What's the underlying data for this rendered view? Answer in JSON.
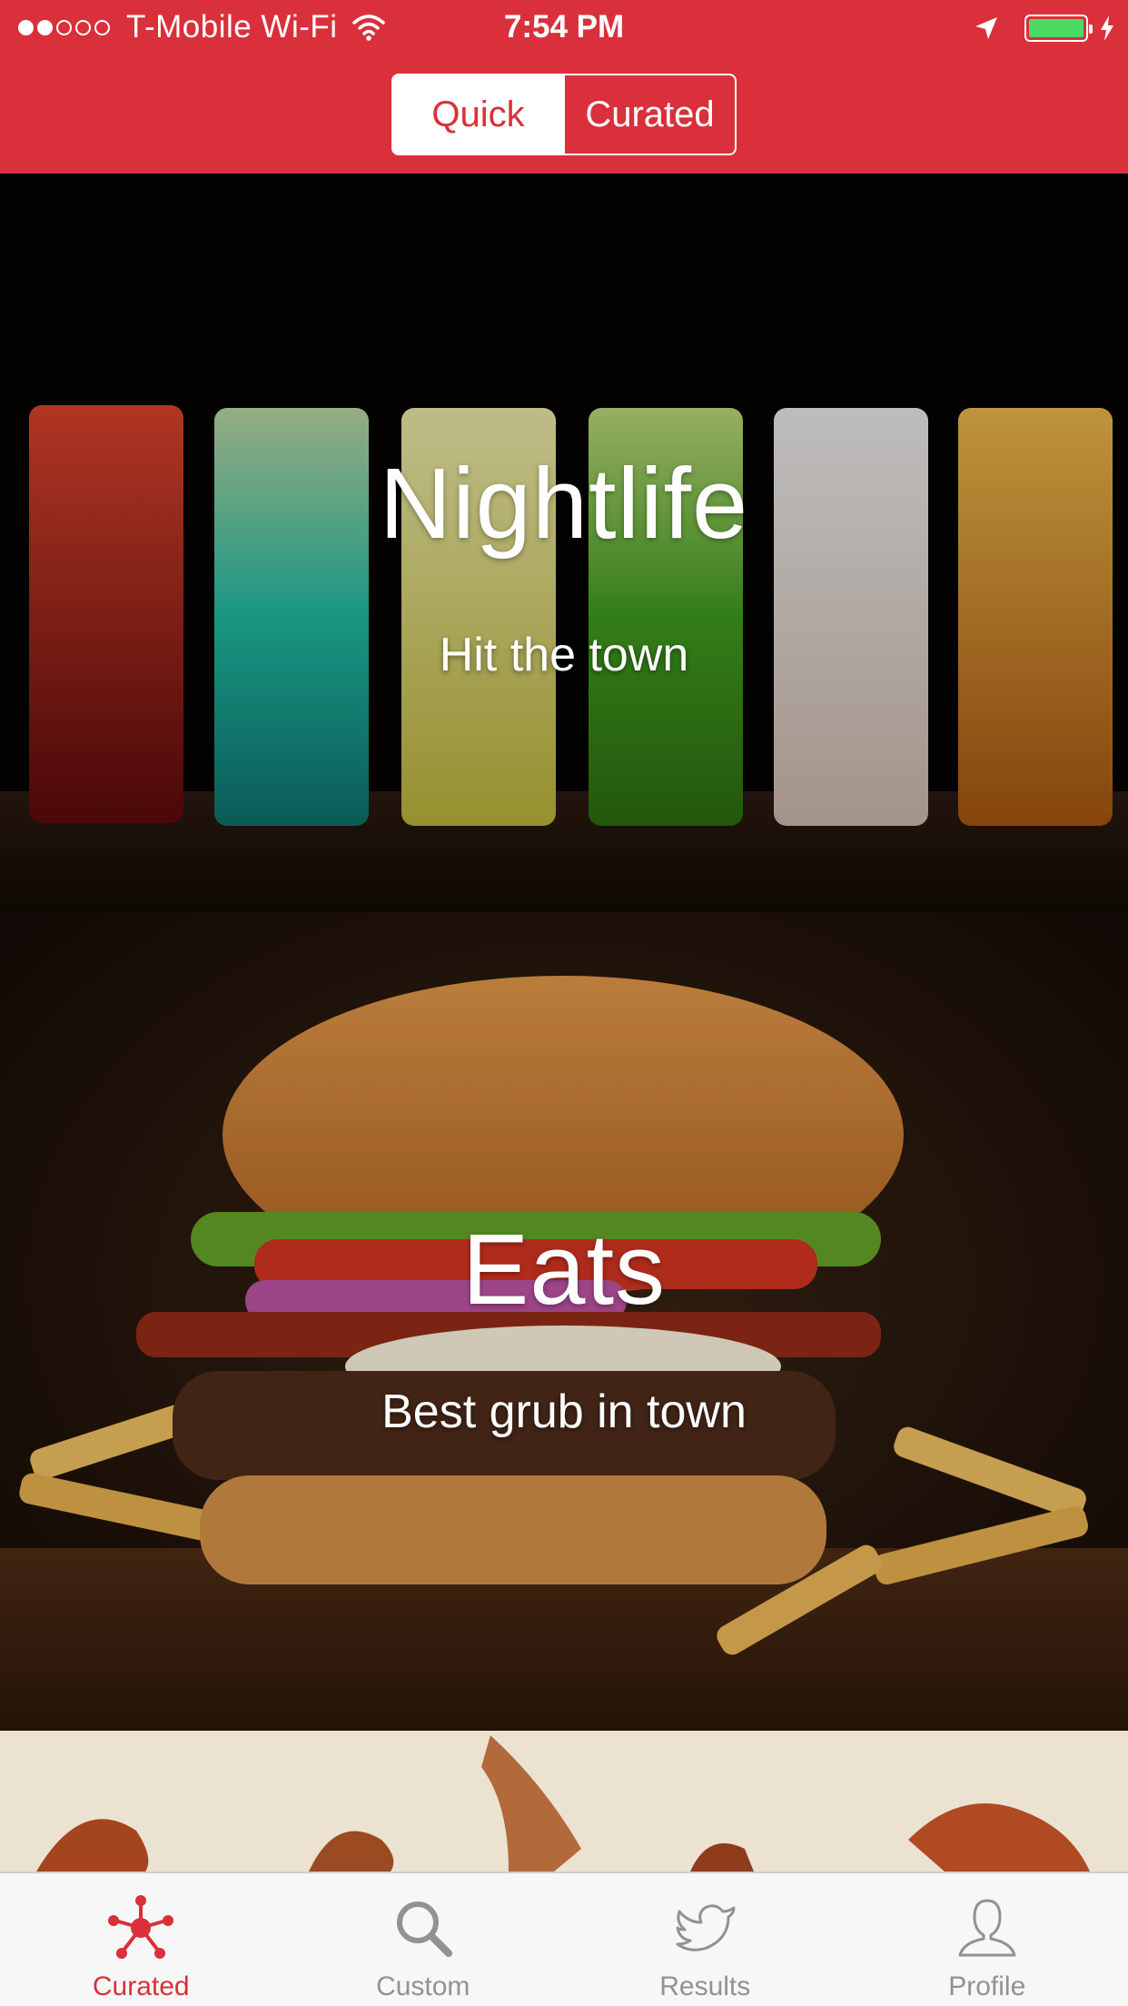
{
  "status_bar": {
    "signal_bars_filled": 2,
    "signal_bars_total": 5,
    "carrier": "T-Mobile Wi-Fi",
    "time": "7:54 PM",
    "battery_level": 1.0,
    "battery_color": "#4cd964",
    "icons": [
      "wifi-icon",
      "location-arrow-icon",
      "battery-icon",
      "charging-bolt-icon"
    ]
  },
  "segmented_control": {
    "options": [
      "Quick",
      "Curated"
    ],
    "selected": "Quick"
  },
  "feed": {
    "cards": [
      {
        "title": "Nightlife",
        "subtitle": "Hit the town",
        "image": "row of colorful cocktails"
      },
      {
        "title": "Eats",
        "subtitle": "Best grub in town",
        "image": "bacon cheeseburger with fries"
      },
      {
        "title": "",
        "subtitle": "",
        "image": "partially visible food photo"
      }
    ]
  },
  "tab_bar": {
    "tabs": [
      {
        "label": "Curated",
        "icon": "network-icon",
        "active": true
      },
      {
        "label": "Custom",
        "icon": "search-icon",
        "active": false
      },
      {
        "label": "Results",
        "icon": "bird-icon",
        "active": false
      },
      {
        "label": "Profile",
        "icon": "person-icon",
        "active": false
      }
    ],
    "active_color": "#d9303b",
    "inactive_color": "#929292"
  },
  "colors": {
    "brand_red": "#d9303b",
    "header_text": "#ffffff"
  }
}
